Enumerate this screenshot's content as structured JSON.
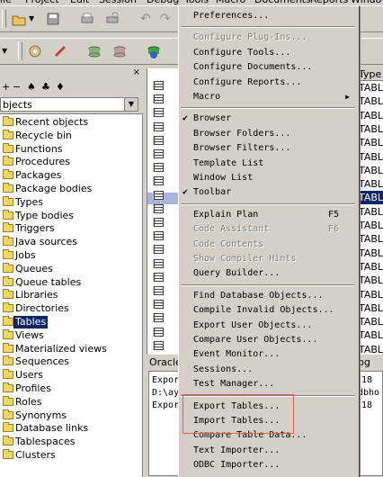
{
  "menubar": {
    "items": [
      "ile",
      "Project",
      "Edit",
      "Session",
      "Debug",
      "Tools",
      "Macro",
      "Documents",
      "Reports",
      "Window"
    ]
  },
  "browser": {
    "close_glyph": "×",
    "tool_glyphs": [
      "+",
      "−",
      "♠",
      "♣",
      "♦"
    ],
    "object_type_value": "bjects",
    "tree_items": [
      "Recent objects",
      "Recycle bin",
      "Functions",
      "Procedures",
      "Packages",
      "Package bodies",
      "Types",
      "Type bodies",
      "Triggers",
      "Java sources",
      "Jobs",
      "Queues",
      "Queue tables",
      "Libraries",
      "Directories",
      "Tables",
      "Views",
      "Materialized views",
      "Sequences",
      "Users",
      "Profiles",
      "Roles",
      "Synonyms",
      "Database links",
      "Tablespaces",
      "Clusters"
    ],
    "selected_item": "Tables"
  },
  "typecol": {
    "header": "Type",
    "cells": [
      "TABLE",
      "TABLE",
      "TABLE",
      "TABLE",
      "TABLE",
      "TABLE",
      "TABLE",
      "TABLE",
      "TABLE",
      "TABLE",
      "TABLE",
      "TABLE",
      "TABLE",
      "TABLE",
      "TABLE",
      "TABLE",
      "TABLE",
      "TABLE",
      "TABLE",
      "TABLE"
    ]
  },
  "bottom": {
    "tab_label": "Oracle",
    "log_label": "Log",
    "output_lines": [
      "Expor",
      "D:\\ay",
      "Expor"
    ],
    "output_right": [
      "18",
      "dbho",
      "18"
    ]
  },
  "tools_menu": {
    "items": [
      {
        "label": "Preferences...",
        "state": "normal"
      },
      {
        "sep": true
      },
      {
        "label": "Configure Plug-Ins...",
        "state": "disabled"
      },
      {
        "label": "Configure Tools...",
        "state": "normal"
      },
      {
        "label": "Configure Documents...",
        "state": "normal"
      },
      {
        "label": "Configure Reports...",
        "state": "normal"
      },
      {
        "label": "Macro",
        "state": "normal",
        "submenu": true
      },
      {
        "sep": true
      },
      {
        "label": "Browser",
        "state": "checked"
      },
      {
        "label": "Browser Folders...",
        "state": "normal"
      },
      {
        "label": "Browser Filters...",
        "state": "normal"
      },
      {
        "label": "Template List",
        "state": "normal"
      },
      {
        "label": "Window List",
        "state": "normal"
      },
      {
        "label": "Toolbar",
        "state": "checked"
      },
      {
        "sep": true
      },
      {
        "label": "Explain Plan",
        "state": "normal",
        "shortcut": "F5"
      },
      {
        "label": "Code Assistant",
        "state": "disabled",
        "shortcut": "F6"
      },
      {
        "label": "Code Contents",
        "state": "disabled"
      },
      {
        "label": "Show Compiler Hints",
        "state": "disabled"
      },
      {
        "label": "Query Builder...",
        "state": "normal"
      },
      {
        "sep": true
      },
      {
        "label": "Find Database Objects...",
        "state": "normal"
      },
      {
        "label": "Compile Invalid Objects...",
        "state": "normal"
      },
      {
        "label": "Export User Objects...",
        "state": "normal"
      },
      {
        "label": "Compare User Objects...",
        "state": "normal"
      },
      {
        "label": "Event Monitor...",
        "state": "normal"
      },
      {
        "label": "Sessions...",
        "state": "normal"
      },
      {
        "label": "Test Manager...",
        "state": "normal"
      },
      {
        "sep": true
      },
      {
        "label": "Export Tables...",
        "state": "normal"
      },
      {
        "label": "Import Tables...",
        "state": "normal"
      },
      {
        "label": "Compare Table Data...",
        "state": "normal"
      },
      {
        "label": "Text Importer...",
        "state": "normal"
      },
      {
        "label": "ODBC Importer...",
        "state": "normal"
      }
    ]
  }
}
